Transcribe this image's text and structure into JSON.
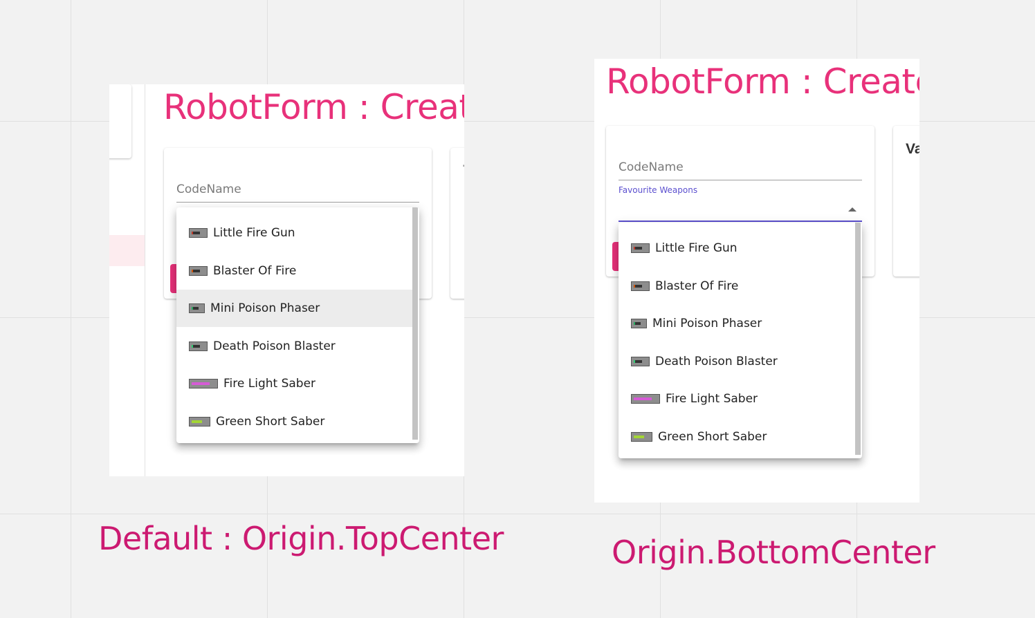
{
  "panels": [
    {
      "title": "RobotForm : Creat",
      "codename_label": "CodeName",
      "menu_items": [
        {
          "label": "Little Fire Gun",
          "icon": "fire-gun-icon"
        },
        {
          "label": "Blaster Of Fire",
          "icon": "fire-blaster-icon"
        },
        {
          "label": "Mini Poison Phaser",
          "icon": "poison-phaser-icon"
        },
        {
          "label": "Death Poison Blaster",
          "icon": "poison-blaster-icon"
        },
        {
          "label": "Fire Light Saber",
          "icon": "fire-saber-icon"
        },
        {
          "label": "Green Short Saber",
          "icon": "green-saber-icon"
        }
      ],
      "highlighted_item": 2,
      "caption": "Default : Origin.TopCenter"
    },
    {
      "title": "RobotForm : Create",
      "codename_label": "CodeName",
      "weapons_label": "Favourite Weapons",
      "side_card_text": "Va",
      "menu_items": [
        {
          "label": "Little Fire Gun",
          "icon": "fire-gun-icon"
        },
        {
          "label": "Blaster Of Fire",
          "icon": "fire-blaster-icon"
        },
        {
          "label": "Mini Poison Phaser",
          "icon": "poison-phaser-icon"
        },
        {
          "label": "Death Poison Blaster",
          "icon": "poison-blaster-icon"
        },
        {
          "label": "Fire Light Saber",
          "icon": "fire-saber-icon"
        },
        {
          "label": "Green Short Saber",
          "icon": "green-saber-icon"
        }
      ],
      "caption": "Origin.BottomCenter"
    }
  ],
  "colors": {
    "accent": "#e8317a",
    "caption": "#cc1a71",
    "focus": "#5b4fcf",
    "highlight": "#ececec"
  }
}
